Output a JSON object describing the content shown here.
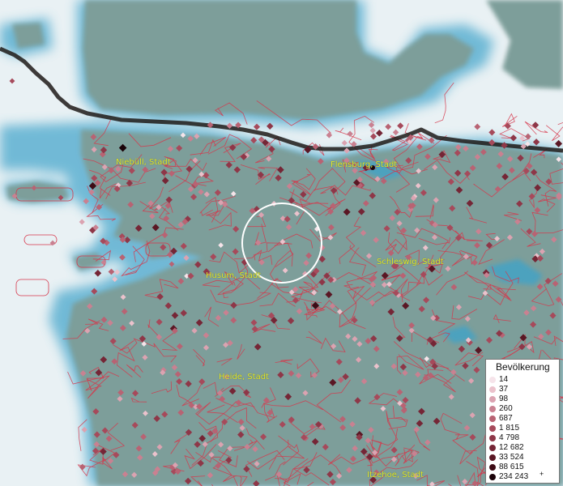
{
  "map": {
    "colors": {
      "water": "#e9f1f4",
      "water_deep": "#3fa3c8",
      "land": "#7d9e9a",
      "land_dark": "#6d8f8a",
      "border": "#d6364a",
      "national_border": "#1e1a17",
      "label": "#e3e629",
      "circle": "#ffffff"
    },
    "places": [
      {
        "id": "niebuell",
        "label": "Niebüll, Stadt"
      },
      {
        "id": "flensburg",
        "label": "Flensburg, Stadt"
      },
      {
        "id": "husum",
        "label": "Husum, Stadt"
      },
      {
        "id": "schleswig",
        "label": "Schleswig, Stadt"
      },
      {
        "id": "heide",
        "label": "Heide, Stadt"
      },
      {
        "id": "itzehoe",
        "label": "Itzehoe, Stadt"
      }
    ]
  },
  "legend": {
    "title": "Bevölkerung",
    "plus_mark": "+",
    "classes": [
      {
        "label": "14",
        "color": "#f6e4ea"
      },
      {
        "label": "37",
        "color": "#ebc2cc"
      },
      {
        "label": "98",
        "color": "#dba3b1"
      },
      {
        "label": "260",
        "color": "#c98191"
      },
      {
        "label": "687",
        "color": "#b86373"
      },
      {
        "label": "1 815",
        "color": "#a64a5b"
      },
      {
        "label": "4 798",
        "color": "#8e3748"
      },
      {
        "label": "12 682",
        "color": "#752636"
      },
      {
        "label": "33 524",
        "color": "#5a1724"
      },
      {
        "label": "88 615",
        "color": "#3d0b15"
      },
      {
        "label": "234 243",
        "color": "#1a0208"
      }
    ]
  }
}
